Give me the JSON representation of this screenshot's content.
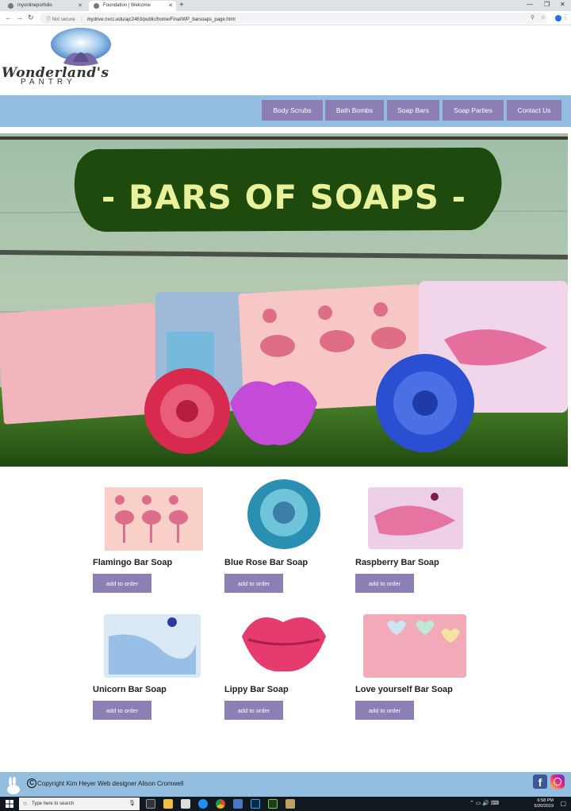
{
  "browser": {
    "tabs": [
      {
        "label": "myonlineporfolio"
      },
      {
        "label": "Foundation | Welcome"
      }
    ],
    "new_tab": "+",
    "security": "Not secure",
    "url": "mydrive.nvcc.edu/ajc2463/public/home/Final/WP_barsoaps_page.html",
    "profile_initial": "B"
  },
  "logo": {
    "name": "Wonderland's",
    "sub": "PANTRY"
  },
  "nav": {
    "items": [
      {
        "label": "Body Scrubs"
      },
      {
        "label": "Bath Bombs"
      },
      {
        "label": "Soap Bars"
      },
      {
        "label": "Soap Parties"
      },
      {
        "label": "Contact Us"
      }
    ]
  },
  "hero": {
    "banner_text": "- BARS OF SOAPS -"
  },
  "products": [
    {
      "name": "Flamingo Bar Soap",
      "button": "add to order"
    },
    {
      "name": "Blue Rose Bar Soap",
      "button": "add to order"
    },
    {
      "name": "Raspberry Bar Soap",
      "button": "add to order"
    },
    {
      "name": "Unicorn Bar Soap",
      "button": "add to order"
    },
    {
      "name": "Lippy Bar Soap",
      "button": "add to order"
    },
    {
      "name": "Love yourself Bar Soap",
      "button": "add to order"
    }
  ],
  "footer": {
    "copyright_symbol": "C",
    "copyright_text": "Copyright Kim Heyer Web designer Alison Cromwell",
    "facebook_glyph": "f"
  },
  "taskbar": {
    "search_placeholder": "Type here to search",
    "time": "6:58 PM",
    "date": "5/20/2019"
  },
  "colors": {
    "nav_bar": "#94bee0",
    "button": "#8e7eb6",
    "banner_green": "#1e4a0e",
    "banner_text": "#e9f19a"
  },
  "icons": [
    "search-icon",
    "microphone-icon",
    "windows-start-icon",
    "facebook-icon",
    "instagram-icon",
    "copyright-icon",
    "back-arrow-icon",
    "forward-arrow-icon",
    "reload-icon",
    "info-icon",
    "zoom-icon",
    "star-icon",
    "menu-dots-icon"
  ]
}
